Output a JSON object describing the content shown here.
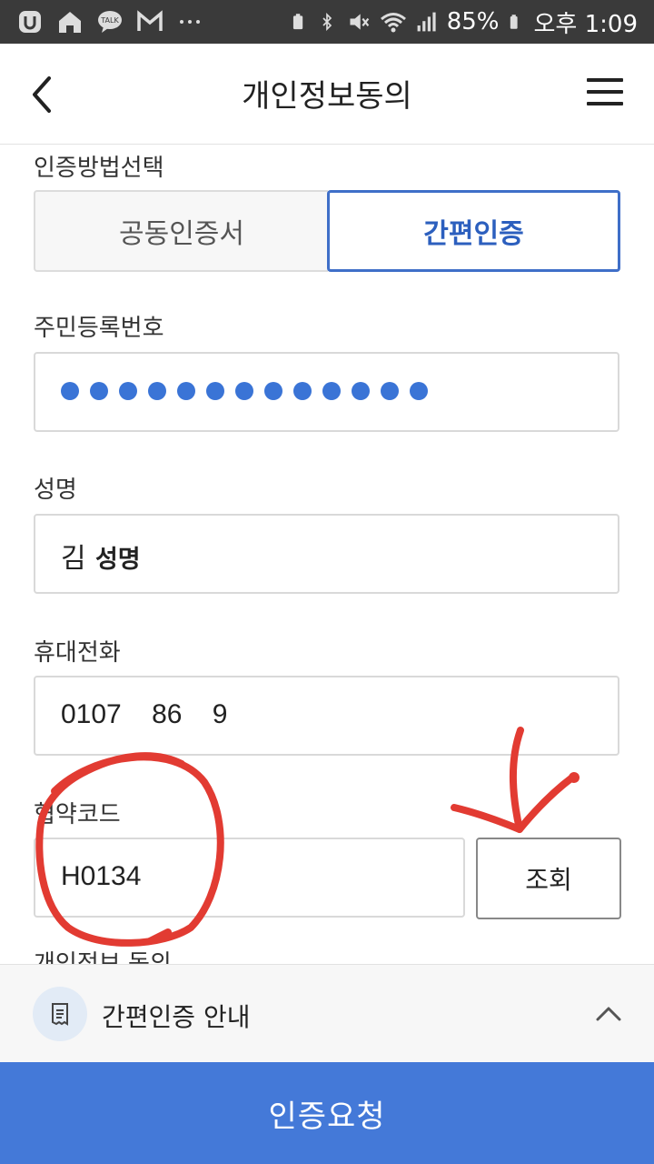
{
  "status_bar": {
    "battery": "85%",
    "time": "오후 1:09",
    "left_icons": [
      "u-app-icon",
      "home-icon",
      "kakaotalk-icon",
      "gmail-icon",
      "more-dots-icon"
    ],
    "right_icons": [
      "battery-saver-icon",
      "bluetooth-icon",
      "mute-icon",
      "wifi-icon",
      "signal-icon",
      "battery-icon"
    ]
  },
  "header": {
    "title": "개인정보동의"
  },
  "auth_method": {
    "label": "인증방법선택",
    "options": [
      "공동인증서",
      "간편인증"
    ],
    "selected": "간편인증"
  },
  "resident_number": {
    "label": "주민등록번호",
    "masked_dot_count": 13
  },
  "name": {
    "label": "성명",
    "value_part1": "김",
    "value_part2": "성명"
  },
  "phone": {
    "label": "휴대전화",
    "value": "0107    86    9"
  },
  "agreement_code": {
    "label": "협약코드",
    "value": "H0134",
    "search_button": "조회"
  },
  "partially_visible_label": "개인정보 동의",
  "guide": {
    "text": "간편인증 안내"
  },
  "submit_button": "인증요청",
  "colors": {
    "accent": "#4479d8",
    "selected_border": "#3f6fc8",
    "annotation": "#e23b32",
    "status_bar": "#3a3a3a"
  }
}
